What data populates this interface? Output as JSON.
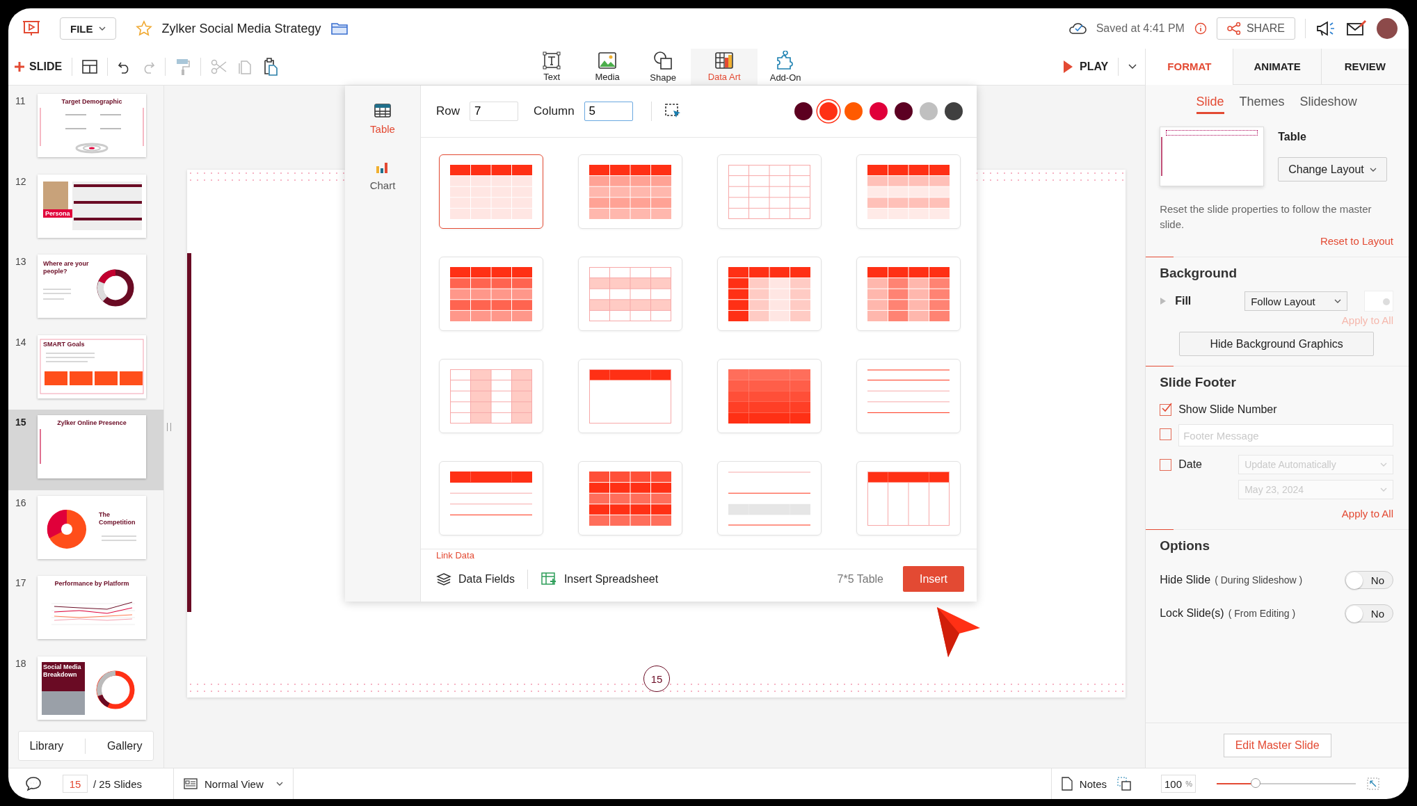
{
  "app": {
    "file_menu": "FILE",
    "document_title": "Zylker Social Media Strategy",
    "save_status": "Saved at 4:41 PM",
    "share": "SHARE"
  },
  "toolbar": {
    "new_slide": "SLIDE",
    "insert_tools": [
      {
        "label": "Text",
        "kind": "text",
        "selected": false
      },
      {
        "label": "Media",
        "kind": "media",
        "selected": false
      },
      {
        "label": "Shape",
        "kind": "shape",
        "selected": false
      },
      {
        "label": "Data Art",
        "kind": "data-art",
        "selected": true
      },
      {
        "label": "Add-On",
        "kind": "add-on",
        "selected": false
      }
    ],
    "play": "PLAY"
  },
  "slides": [
    {
      "number": "11",
      "kind": "target",
      "title": "Target Demographic",
      "selected": false
    },
    {
      "number": "12",
      "kind": "persona",
      "title": "Persona",
      "selected": false
    },
    {
      "number": "13",
      "kind": "donut",
      "title": "Where are your people?",
      "selected": false
    },
    {
      "number": "14",
      "kind": "goals",
      "title": "SMART Goals",
      "selected": false
    },
    {
      "number": "15",
      "kind": "blank",
      "title": "Zylker Online Presence",
      "selected": true
    },
    {
      "number": "16",
      "kind": "pie",
      "title": "The Competition",
      "selected": false
    },
    {
      "number": "17",
      "kind": "line-chart",
      "title": "Performance by Platform",
      "selected": false
    },
    {
      "number": "18",
      "kind": "breakdown",
      "title": "Social Media Breakdown",
      "selected": false
    }
  ],
  "library_tabs": [
    "Library",
    "Gallery"
  ],
  "slide": {
    "number": "15"
  },
  "data_art": {
    "categories": [
      {
        "label": "Table",
        "kind": "table",
        "selected": true
      },
      {
        "label": "Chart",
        "kind": "chart",
        "selected": false
      }
    ],
    "row_label": "Row",
    "row_value": "7",
    "column_label": "Column",
    "column_value": "5",
    "colors": [
      {
        "color": "#5c0020",
        "selected": false
      },
      {
        "color": "#ff3015",
        "selected": true
      },
      {
        "color": "#ff5a00",
        "selected": false
      },
      {
        "color": "#e0003a",
        "selected": false
      },
      {
        "color": "#5c0022",
        "selected": false
      },
      {
        "color": "#c0c0c0",
        "selected": false
      },
      {
        "color": "#404040",
        "selected": false
      }
    ],
    "templates": [
      {
        "kind": "header-light",
        "selected": true
      },
      {
        "kind": "header-tinted",
        "selected": false
      },
      {
        "kind": "outline-grid",
        "selected": false
      },
      {
        "kind": "header-banded",
        "selected": false
      },
      {
        "kind": "banded-strong",
        "selected": false
      },
      {
        "kind": "banded-outline",
        "selected": false
      },
      {
        "kind": "first-column",
        "selected": false
      },
      {
        "kind": "column-banded",
        "selected": false
      },
      {
        "kind": "column-highlight",
        "selected": false
      },
      {
        "kind": "header-only",
        "selected": false
      },
      {
        "kind": "gradient",
        "selected": false
      },
      {
        "kind": "lines",
        "selected": false
      },
      {
        "kind": "header-rows",
        "selected": false
      },
      {
        "kind": "stripe-strong",
        "selected": false
      },
      {
        "kind": "gray-bands",
        "selected": false
      },
      {
        "kind": "header-columns",
        "selected": false
      }
    ],
    "link_data": "Link Data",
    "data_fields": "Data Fields",
    "insert_spreadsheet": "Insert Spreadsheet",
    "summary": "7*5 Table",
    "insert": "Insert"
  },
  "panel_tabs": [
    {
      "label": "FORMAT",
      "selected": true
    },
    {
      "label": "ANIMATE",
      "selected": false
    },
    {
      "label": "REVIEW",
      "selected": false
    }
  ],
  "format": {
    "sub_tabs": [
      {
        "label": "Slide",
        "selected": true
      },
      {
        "label": "Themes",
        "selected": false
      },
      {
        "label": "Slideshow",
        "selected": false
      }
    ],
    "layout_name": "Table",
    "change_layout": "Change Layout",
    "reset_note": "Reset the slide properties to follow the master slide.",
    "reset_link": "Reset to Layout",
    "background": {
      "heading": "Background",
      "fill_label": "Fill",
      "fill_value": "Follow Layout",
      "apply_all": "Apply to All",
      "apply_all_disabled": true,
      "hide_graphics": "Hide Background Graphics"
    },
    "footer": {
      "heading": "Slide Footer",
      "items": [
        {
          "kind": "checkbox",
          "label": "Show Slide Number",
          "checked": true
        },
        {
          "kind": "field",
          "placeholder": "Footer Message",
          "checked": false
        },
        {
          "kind": "date",
          "label": "Date",
          "checked": false,
          "value": "Update Automatically",
          "date": "May 23, 2024"
        }
      ],
      "apply_all": "Apply to All"
    },
    "options": {
      "heading": "Options",
      "items": [
        {
          "label": "Hide Slide",
          "note": "( During Slideshow )",
          "on": false,
          "state_text": "No"
        },
        {
          "label": "Lock Slide(s)",
          "note": "( From Editing )",
          "on": false,
          "state_text": "No"
        }
      ]
    },
    "edit_master": "Edit Master Slide"
  },
  "status_bar": {
    "current_slide": "15",
    "total": "/ 25 Slides",
    "view": "Normal View",
    "notes": "Notes",
    "zoom": "100",
    "zoom_unit": "%",
    "zoom_slider": {
      "level": 0.28
    }
  }
}
